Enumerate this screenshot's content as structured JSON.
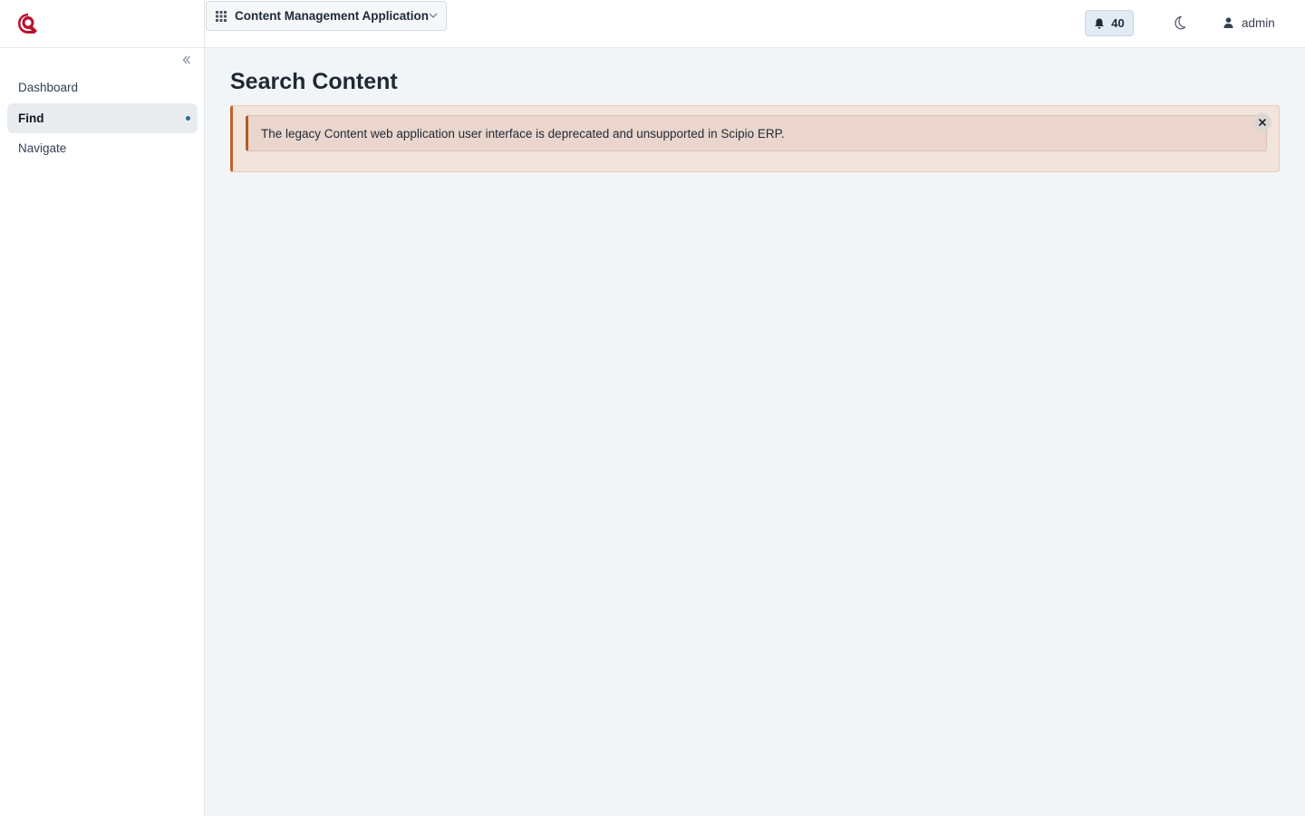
{
  "sidebar": {
    "logo_icon": "scipio-logo-icon",
    "collapse_icon": "double-chevron-left-icon",
    "items": [
      {
        "label": "Dashboard",
        "active": false
      },
      {
        "label": "Find",
        "active": true
      },
      {
        "label": "Navigate",
        "active": false
      }
    ]
  },
  "topbar": {
    "app_switcher": {
      "icon": "grid-icon",
      "label": "Content Management Application",
      "chevron": "chevron-down-icon"
    },
    "notifications": {
      "icon": "bell-icon",
      "count": "40"
    },
    "theme_toggle": {
      "icon": "moon-icon"
    },
    "user": {
      "icon": "user-icon",
      "name": "admin"
    }
  },
  "main": {
    "title": "Search Content",
    "alert": {
      "message": "The legacy Content web application user interface is deprecated and unsupported in Scipio ERP.",
      "close_icon": "close-icon"
    }
  },
  "colors": {
    "brand": "#b8122e",
    "active_dot": "#1d6fa3",
    "alert_border": "#c4612a",
    "alert_bg": "#f1e4dc",
    "page_bg": "#f2f5f8"
  }
}
